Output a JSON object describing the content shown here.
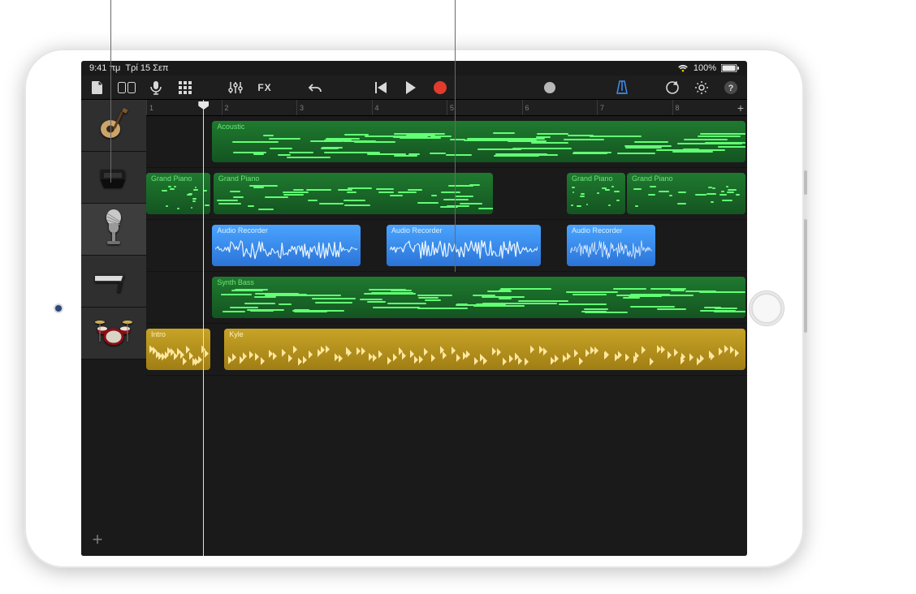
{
  "status": {
    "time": "9:41 πμ",
    "date": "Τρί 15 Σεπ",
    "battery": "100%"
  },
  "toolbar": {
    "fx": "FX"
  },
  "ruler": {
    "marks": [
      "1",
      "2",
      "3",
      "4",
      "5",
      "6",
      "7",
      "8"
    ],
    "playhead_bar_fraction": 0.095,
    "add": "+"
  },
  "tracks": [
    {
      "id": "acoustic",
      "icon": "guitar-icon",
      "selected": false,
      "regions": [
        {
          "type": "midi",
          "label": "Acoustic",
          "start": 0.11,
          "end": 1.0
        }
      ]
    },
    {
      "id": "piano",
      "icon": "piano-icon",
      "selected": false,
      "regions": [
        {
          "type": "midi",
          "label": "Grand Piano",
          "start": 0.0,
          "end": 0.11
        },
        {
          "type": "midi",
          "label": "Grand Piano",
          "start": 0.112,
          "end": 0.58
        },
        {
          "type": "midi",
          "label": "Grand Piano",
          "start": 0.7,
          "end": 0.8
        },
        {
          "type": "midi",
          "label": "Grand Piano",
          "start": 0.8,
          "end": 1.0
        }
      ]
    },
    {
      "id": "mic",
      "icon": "mic-track-icon",
      "selected": true,
      "regions": [
        {
          "type": "audio",
          "label": "Audio Recorder",
          "start": 0.11,
          "end": 0.36
        },
        {
          "type": "audio",
          "label": "Audio Recorder",
          "start": 0.4,
          "end": 0.66
        },
        {
          "type": "audio",
          "label": "Audio Recorder",
          "start": 0.7,
          "end": 0.85
        }
      ]
    },
    {
      "id": "synth",
      "icon": "synth-icon",
      "selected": false,
      "regions": [
        {
          "type": "midi",
          "label": "Synth Bass",
          "start": 0.11,
          "end": 1.0
        }
      ]
    },
    {
      "id": "drums",
      "icon": "drums-icon",
      "selected": false,
      "regions": [
        {
          "type": "drum",
          "label": "Intro",
          "start": 0.0,
          "end": 0.11
        },
        {
          "type": "drum",
          "label": "Kyle",
          "start": 0.13,
          "end": 1.0
        }
      ]
    }
  ],
  "add_track_label": "+"
}
